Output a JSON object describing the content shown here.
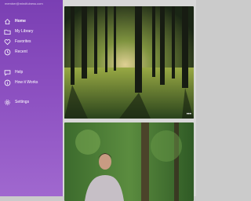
{
  "account": {
    "email": "member@mindfulness.com"
  },
  "nav": [
    {
      "label": "Home",
      "icon": "home-icon",
      "active": true
    },
    {
      "label": "My Library",
      "icon": "folder-icon"
    },
    {
      "label": "Favorites",
      "icon": "heart-icon"
    },
    {
      "label": "Recent",
      "icon": "clock-icon"
    },
    {
      "label": "Help",
      "icon": "chat-icon"
    },
    {
      "label": "How it Works",
      "icon": "info-icon"
    },
    {
      "label": "Settings",
      "icon": "gear-icon"
    }
  ],
  "cards": [
    {
      "image": "forest-sunlight-image",
      "menu": "•••"
    },
    {
      "image": "meditating-woman-forest-image"
    }
  ],
  "colors": {
    "sidebar_top": "#7a3fb3",
    "sidebar_bottom": "#a068cf",
    "background": "#d7d7d7"
  }
}
